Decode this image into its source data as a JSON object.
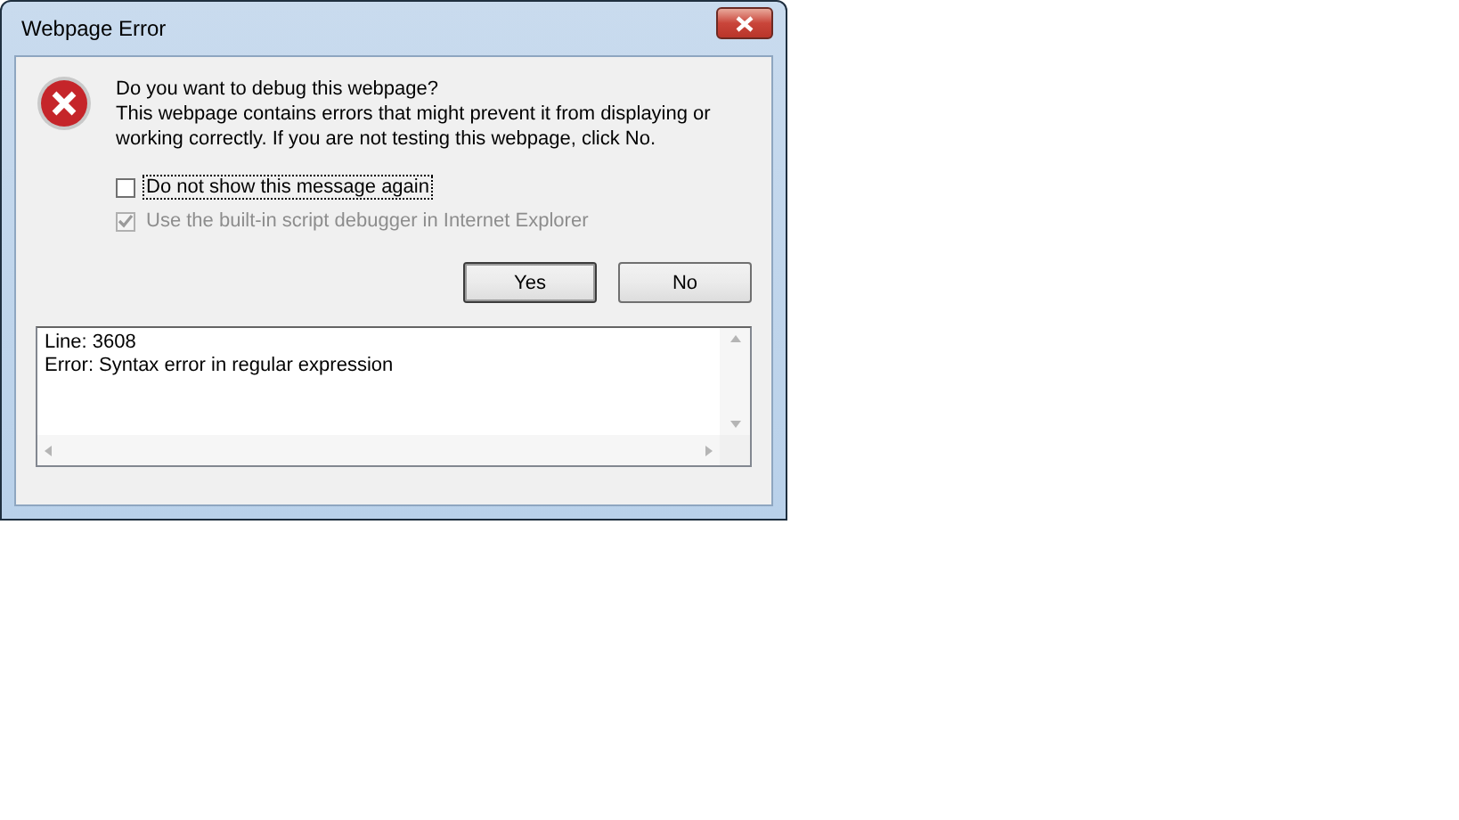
{
  "window": {
    "title": "Webpage Error"
  },
  "message": {
    "heading": "Do you want to debug this webpage?",
    "body": "This webpage contains errors that might prevent it from displaying or working correctly. If you are not testing this webpage, click No."
  },
  "options": [
    {
      "label": "Do not show this message again",
      "checked": false,
      "disabled": false,
      "focused": true
    },
    {
      "label": "Use the built-in script debugger in Internet Explorer",
      "checked": true,
      "disabled": true,
      "focused": false
    }
  ],
  "buttons": [
    {
      "label": "Yes",
      "default": true
    },
    {
      "label": "No",
      "default": false
    }
  ],
  "details": {
    "lines": [
      "Line: 3608",
      "Error: Syntax error in regular expression"
    ]
  }
}
